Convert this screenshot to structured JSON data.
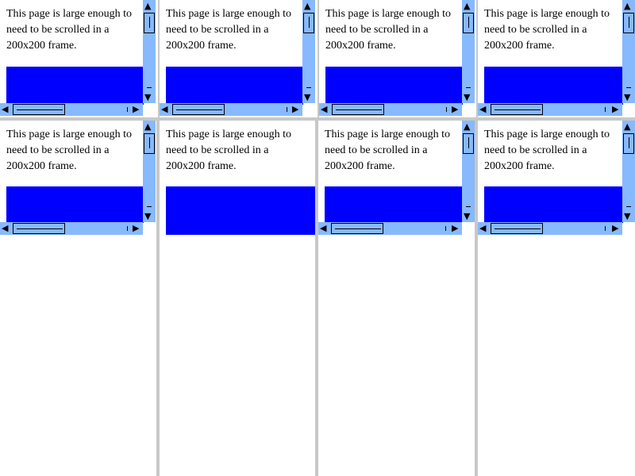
{
  "frames": [
    {
      "text": "This page is large enough to need to be scrolled in a 200x200 frame."
    },
    {
      "text": "This page is large enough to need to be scrolled in a 200x200 frame."
    },
    {
      "text": "This page is large enough to need to be scrolled in a 200x200 frame."
    },
    {
      "text": "This page is large enough to need to be scrolled in a 200x200 frame."
    },
    {
      "text": "This page is large enough to need to be scrolled in a 200x200 frame."
    },
    {
      "text": "This page is large enough to need to be scrolled in a 200x200 frame."
    },
    {
      "text": "This page is large enough to need to be scrolled in a 200x200 frame."
    },
    {
      "text": "This page is large enough to need to be scrolled in a 200x200 frame."
    }
  ],
  "colors": {
    "block": "#0000ff",
    "scrollbar": "#87b9ff",
    "divider": "#c8c8c8"
  },
  "icons": {
    "up": "▲",
    "down": "▼",
    "left": "◀",
    "right": "▶"
  }
}
